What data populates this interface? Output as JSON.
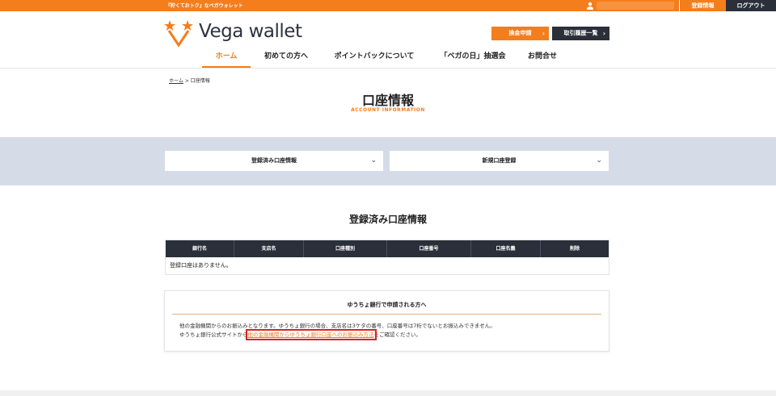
{
  "topbar": {
    "tagline": "『貯くてお卜ク』なベガウォレット",
    "user_field": "",
    "registration_info": "登録情報",
    "logout": "ログアウト"
  },
  "header": {
    "logo_text": "Vega wallet",
    "exchange_button": "換金申請",
    "history_button": "取引履歴一覧"
  },
  "nav": {
    "items": [
      {
        "label": "ホーム"
      },
      {
        "label": "初めての方へ"
      },
      {
        "label": "ポイントバックについて"
      },
      {
        "label": "「ベガの日」抽選会"
      },
      {
        "label": "お問合せ"
      }
    ]
  },
  "breadcrumb": {
    "home": "ホーム",
    "separator": ">",
    "current": "口座情報"
  },
  "page": {
    "title": "口座情報",
    "subtitle": "ACCOUNT INFORMATION"
  },
  "dropdowns": {
    "registered": "登録済み口座情報",
    "new": "新規口座登録"
  },
  "registered_section": {
    "title": "登録済み口座情報",
    "columns": [
      "銀行名",
      "支店名",
      "口座種別",
      "口座番号",
      "口座名義",
      "削除"
    ],
    "empty_message": "登録口座はありません。"
  },
  "yucho_box": {
    "title": "ゆうちょ銀行で申請される方へ",
    "line1": "他の金融機関からのお振込みとなります。ゆうちょ銀行の場合、支店名は3ケタの番号、口座番号は7桁でないとお振込みできません。",
    "line2_prefix": "ゆうちょ銀行公式サイトから",
    "line2_link": "他の金融機関からゆうちょ銀行口座へのお振込み方法",
    "line2_suffix": "をご確認ください。"
  },
  "colors": {
    "accent": "#f47d1c",
    "dark": "#2a2f3a",
    "band": "#d5dce8"
  }
}
